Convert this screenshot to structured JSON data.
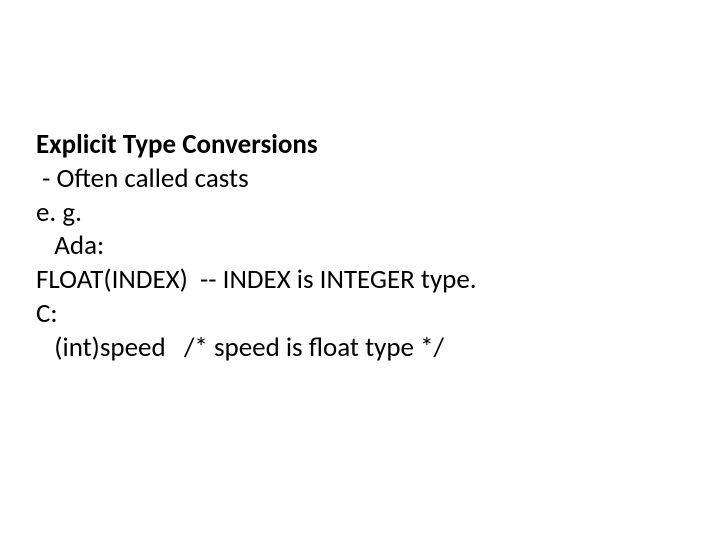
{
  "slide": {
    "heading": "Explicit Type Conversions",
    "lines": [
      " - Often called casts",
      "e. g. ",
      "   Ada:",
      "FLOAT(INDEX)  -- INDEX is INTEGER type.",
      "C:",
      "   (int)speed   /* speed is float type */"
    ]
  }
}
